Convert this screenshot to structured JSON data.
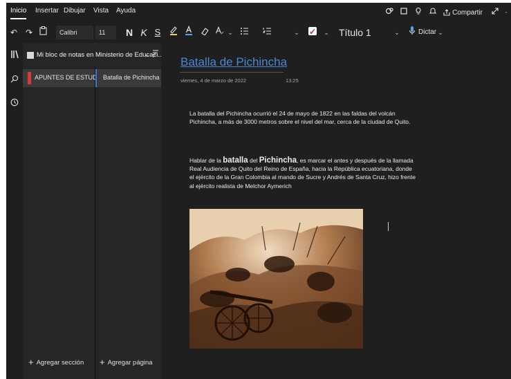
{
  "menu": {
    "tabs": [
      "Inicio",
      "Insertar",
      "Dibujar",
      "Vista",
      "Ayuda"
    ],
    "share_label": "Compartir"
  },
  "toolbar": {
    "font_name": "Calibri",
    "font_size": "11",
    "bold_label": "N",
    "italic_label": "K",
    "underline_label": "S",
    "style_label": "Título 1",
    "dictate_label": "Dictar"
  },
  "notebook": {
    "name": "Mi bloc de notas en Ministerio de Educaci...",
    "sections": [
      "APUNTES DE ESTUDIO..."
    ],
    "pages": [
      "Batalla de Pichincha"
    ],
    "add_section": "Agregar sección",
    "add_page": "Agregar página"
  },
  "page": {
    "title": "Batalla de Pichincha",
    "date": "viernes, 4 de marzo de 2022",
    "time": "13:25",
    "para1": "La batalla del Pichincha ocurrió el 24 de mayo de 1822 en las faldas del volcán Pichincha, a más de 3000 metros sobre el nivel del mar, cerca de la ciudad de Quito.",
    "para2_a": "Hablar de la ",
    "para2_b": "batalla",
    "para2_c": " del ",
    "para2_d": "Pichincha",
    "para2_e": ", es marcar el antes y después de la llamada Real Audiencia de Quito del Reino de España, hacia la República ecuatoriana, donde el ejército de la Gran Colombia al mando de Sucre y Andrés de Santa Cruz, hizo frente al ejército realista de Melchor Aymerich"
  },
  "colors": {
    "accent": "#4a87d8",
    "section_color": "#d83b3b",
    "background": "#1f1f1f"
  }
}
